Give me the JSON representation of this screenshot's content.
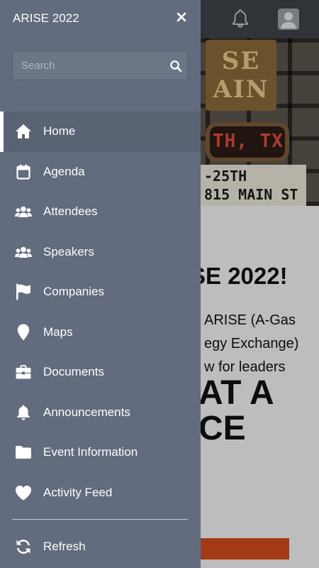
{
  "drawer": {
    "title": "ARISE 2022",
    "search": {
      "placeholder": "Search"
    },
    "nav_items": [
      {
        "label": "Home",
        "icon": "home-icon",
        "active": true
      },
      {
        "label": "Agenda",
        "icon": "calendar-icon"
      },
      {
        "label": "Attendees",
        "icon": "users-icon"
      },
      {
        "label": "Speakers",
        "icon": "users-icon"
      },
      {
        "label": "Companies",
        "icon": "flag-icon"
      },
      {
        "label": "Maps",
        "icon": "map-pin-icon"
      },
      {
        "label": "Documents",
        "icon": "briefcase-icon"
      },
      {
        "label": "Announcements",
        "icon": "bell-icon"
      },
      {
        "label": "Event Information",
        "icon": "folder-icon"
      },
      {
        "label": "Activity Feed",
        "icon": "heart-icon"
      }
    ],
    "refresh_label": "Refresh"
  },
  "background": {
    "banner_sign": "SE\nAIN",
    "banner_marquee": "TH, TX",
    "banner_board_line1": "-25TH",
    "banner_board_line2": "815 MAIN ST",
    "heading": "SE 2022!",
    "para_line1": "ARISE (A-Gas",
    "para_line2": "egy Exchange)",
    "para_line3": "w for leaders",
    "big_line1": "AT A",
    "big_line2": "CE"
  },
  "colors": {
    "drawer_bg": "#626c7e",
    "active_item_bg": "#5a6374",
    "header_bg": "#3e4247",
    "accent_button": "#d24a1b"
  }
}
